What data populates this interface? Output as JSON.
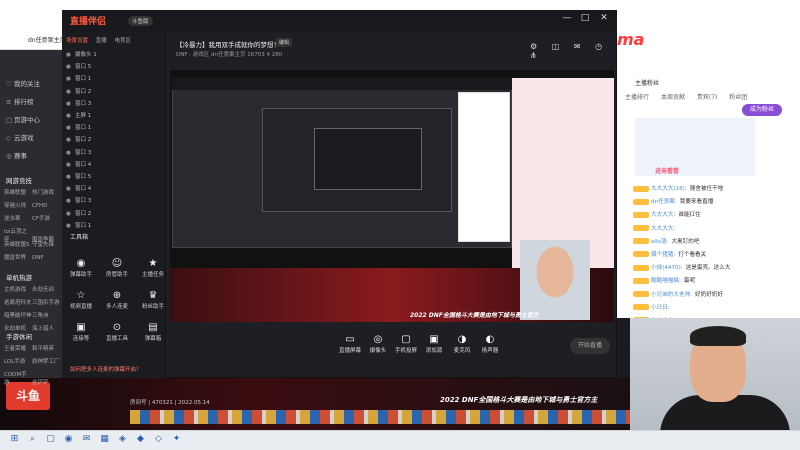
{
  "browser": {
    "tab_label": "dn任意案主页"
  },
  "left_nav": {
    "items": [
      {
        "icon": "♡",
        "label": "我的关注"
      },
      {
        "icon": "≡",
        "label": "排行榜"
      },
      {
        "icon": "□",
        "label": "页游中心"
      },
      {
        "icon": "◇",
        "label": "云游戏"
      },
      {
        "icon": "◎",
        "label": "赛事"
      }
    ],
    "section_hot": "网游竞技",
    "hot_games": [
      "英雄联盟",
      "热门游戏",
      "穿越火线",
      "CFHD",
      "逆水寒",
      "CF手游",
      "lol云顶之弈",
      "魔兽争霸",
      "英雄联盟S",
      "守望先锋",
      "魔兽世界",
      "DNF"
    ],
    "section_mobile": "单机热游",
    "mobile_games": [
      "主机游戏",
      "永劫无间",
      "逃离塔科夫",
      "三国杀手游",
      "暗黑破坏神",
      "三角洲",
      "永劫单机",
      "海上猎人"
    ],
    "section_entertain": "手游休闲",
    "entertain": [
      "王者荣耀",
      "和平精英",
      "LOL手游",
      "原神梦工厂",
      "CODM手游",
      "金铲铲"
    ]
  },
  "app": {
    "logo": "直播伴侣",
    "version": "斗鱼版",
    "scene_tabs": [
      "场景设置",
      "直播",
      "电竞区"
    ],
    "scenes": [
      "摄像头 1",
      "窗口 5",
      "窗口 1",
      "窗口 2",
      "窗口 3",
      "主屏 1",
      "窗口 1",
      "窗口 2",
      "窗口 3",
      "窗口 4",
      "窗口 5",
      "窗口 4",
      "窗口 3",
      "窗口 2",
      "窗口 1"
    ],
    "tools_title": "工具箱",
    "tools": [
      {
        "icon": "◉",
        "label": "弹幕助手"
      },
      {
        "icon": "☺",
        "label": "房管助手"
      },
      {
        "icon": "★",
        "label": "主播任务"
      },
      {
        "icon": "☆",
        "label": "视频直播"
      },
      {
        "icon": "⊕",
        "label": "多人连麦"
      },
      {
        "icon": "♛",
        "label": "粉丝助手"
      },
      {
        "icon": "▣",
        "label": "连接等"
      },
      {
        "icon": "⊙",
        "label": "直播工具"
      },
      {
        "icon": "▤",
        "label": "弹幕箱"
      }
    ],
    "tip": "如何把多人连麦的弹幕开启？",
    "stream_title": "【冷暴力】我用双手成就你的梦想！",
    "edit_label": "编辑",
    "stream_meta": "DNF · 游戏区  dn任意案主页  16703  4  280",
    "preview_caption": "2022 DNF全国格斗大赛是由地下城与勇士官方",
    "controls": [
      {
        "icon": "▭",
        "label": "直播屏幕"
      },
      {
        "icon": "◎",
        "label": "摄像头"
      },
      {
        "icon": "▢",
        "label": "手机投屏"
      },
      {
        "icon": "▣",
        "label": "添加源"
      },
      {
        "icon": "◑",
        "label": "麦克风"
      },
      {
        "icon": "◐",
        "label": "扬声器"
      }
    ],
    "live_button": "开始直播"
  },
  "stream_page": {
    "brand": "ma",
    "fan_label": "主播粉丝",
    "tabs": [
      "主播排行",
      "本周贡献",
      "贵宾(7)",
      "粉丝团"
    ],
    "gift_button": "成为粉丝",
    "banner_text": "进来看看",
    "chat": [
      {
        "user": "大大大大(18):",
        "msg": "随舍被任干啥"
      },
      {
        "user": "dn任意案:",
        "msg": "我要来看直播"
      },
      {
        "user": "大大大大:",
        "msg": "谁能扛住"
      },
      {
        "user": "大大大大:",
        "msg": ""
      },
      {
        "user": "allo落:",
        "msg": "大奥钉的吧"
      },
      {
        "user": "爆个猪猪:",
        "msg": "打个看看关"
      },
      {
        "user": "小侠(4470):",
        "msg": "这是蛋壳。这么大"
      },
      {
        "user": "酷酷喵喵猫:",
        "msg": "蛋呢"
      },
      {
        "user": "小兄弟的大老帅:",
        "msg": "好奶好奶好"
      },
      {
        "user": "小日日:",
        "msg": ""
      },
      {
        "user": "大大大大:",
        "msg": ""
      }
    ]
  },
  "bottom": {
    "logo": "斗鱼",
    "room_info": "房间号 | 470321 | 2022.05.14",
    "caption": "2022 DNF全国格斗大赛是由地下城与勇士官方主"
  },
  "taskbar": {
    "icons": [
      "⊞",
      "⌕",
      "▢",
      "◉",
      "✉",
      "▦",
      "◈",
      "◆",
      "◇",
      "✦"
    ]
  },
  "colors": {
    "accent": "#ff5a3c",
    "brand_red": "#e23a2c",
    "purple": "#8a4dd6"
  }
}
